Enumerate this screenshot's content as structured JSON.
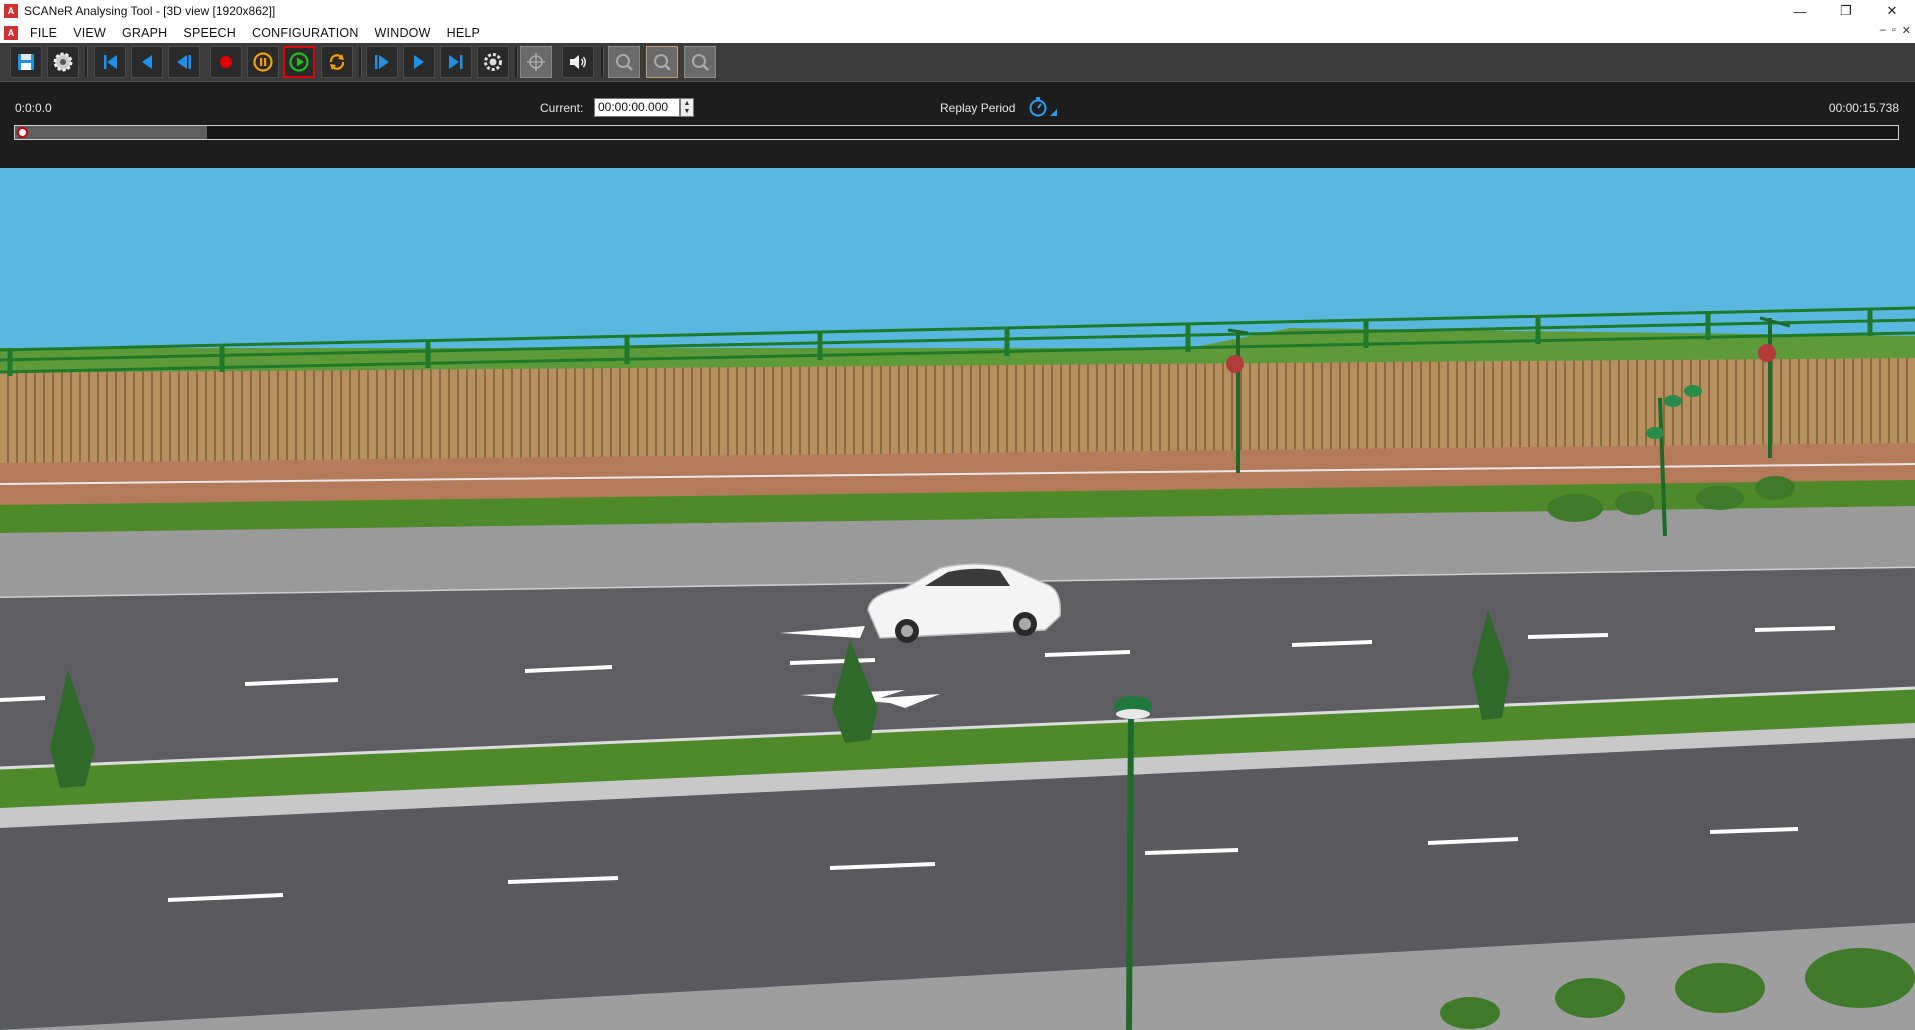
{
  "window": {
    "title": "SCANeR Analysing Tool - [3D view [1920x862]]",
    "app_icon_letter": "A",
    "controls": {
      "minimize": "—",
      "restore": "❐",
      "close": "✕"
    }
  },
  "menu": {
    "items": [
      "FILE",
      "VIEW",
      "GRAPH",
      "SPEECH",
      "CONFIGURATION",
      "WINDOW",
      "HELP"
    ],
    "mdi_controls": {
      "minimize": "‒",
      "restore": "▫",
      "close": "✕"
    }
  },
  "toolbar": {
    "buttons": [
      {
        "name": "save",
        "icon": "floppy-disk-icon",
        "state": "normal"
      },
      {
        "name": "settings",
        "icon": "gear-icon",
        "state": "normal"
      },
      {
        "name": "go-to-start",
        "icon": "skip-to-start-icon",
        "state": "normal"
      },
      {
        "name": "step-back",
        "icon": "step-back-icon",
        "state": "normal"
      },
      {
        "name": "play-reverse",
        "icon": "play-reverse-icon",
        "state": "normal"
      },
      {
        "name": "record",
        "icon": "record-icon",
        "state": "normal"
      },
      {
        "name": "pause",
        "icon": "pause-icon",
        "state": "normal"
      },
      {
        "name": "play",
        "icon": "play-icon",
        "state": "active"
      },
      {
        "name": "loop",
        "icon": "loop-icon",
        "state": "normal"
      },
      {
        "name": "play-forward",
        "icon": "play-forward-icon",
        "state": "normal"
      },
      {
        "name": "step-forward",
        "icon": "step-forward-icon",
        "state": "normal"
      },
      {
        "name": "go-to-end",
        "icon": "skip-to-end-icon",
        "state": "normal"
      },
      {
        "name": "camera-settings",
        "icon": "camera-gear-icon",
        "state": "normal"
      },
      {
        "name": "crosshair",
        "icon": "crosshair-icon",
        "state": "disabled"
      },
      {
        "name": "sound",
        "icon": "speaker-icon",
        "state": "normal"
      },
      {
        "name": "zoom-x",
        "icon": "zoom-x-icon",
        "state": "disabled"
      },
      {
        "name": "zoom-fit",
        "icon": "zoom-fit-icon",
        "state": "disabled"
      },
      {
        "name": "zoom-y",
        "icon": "zoom-y-icon",
        "state": "disabled"
      }
    ]
  },
  "timeline": {
    "start_time": "0:0:0.0",
    "current_label": "Current:",
    "current_value": "00:00:00.000",
    "replay_period_label": "Replay Period",
    "end_time": "00:00:15.738",
    "buffered_fraction": 0.102,
    "position_fraction": 0.0
  },
  "colors": {
    "toolbar_bg": "#3b3b3b",
    "timeline_bg": "#1d1d1d",
    "sky": "#5ab8e0",
    "record_red": "#e00000",
    "play_green": "#19c319",
    "icon_blue": "#1e90e8",
    "pause_orange": "#f0a000"
  }
}
